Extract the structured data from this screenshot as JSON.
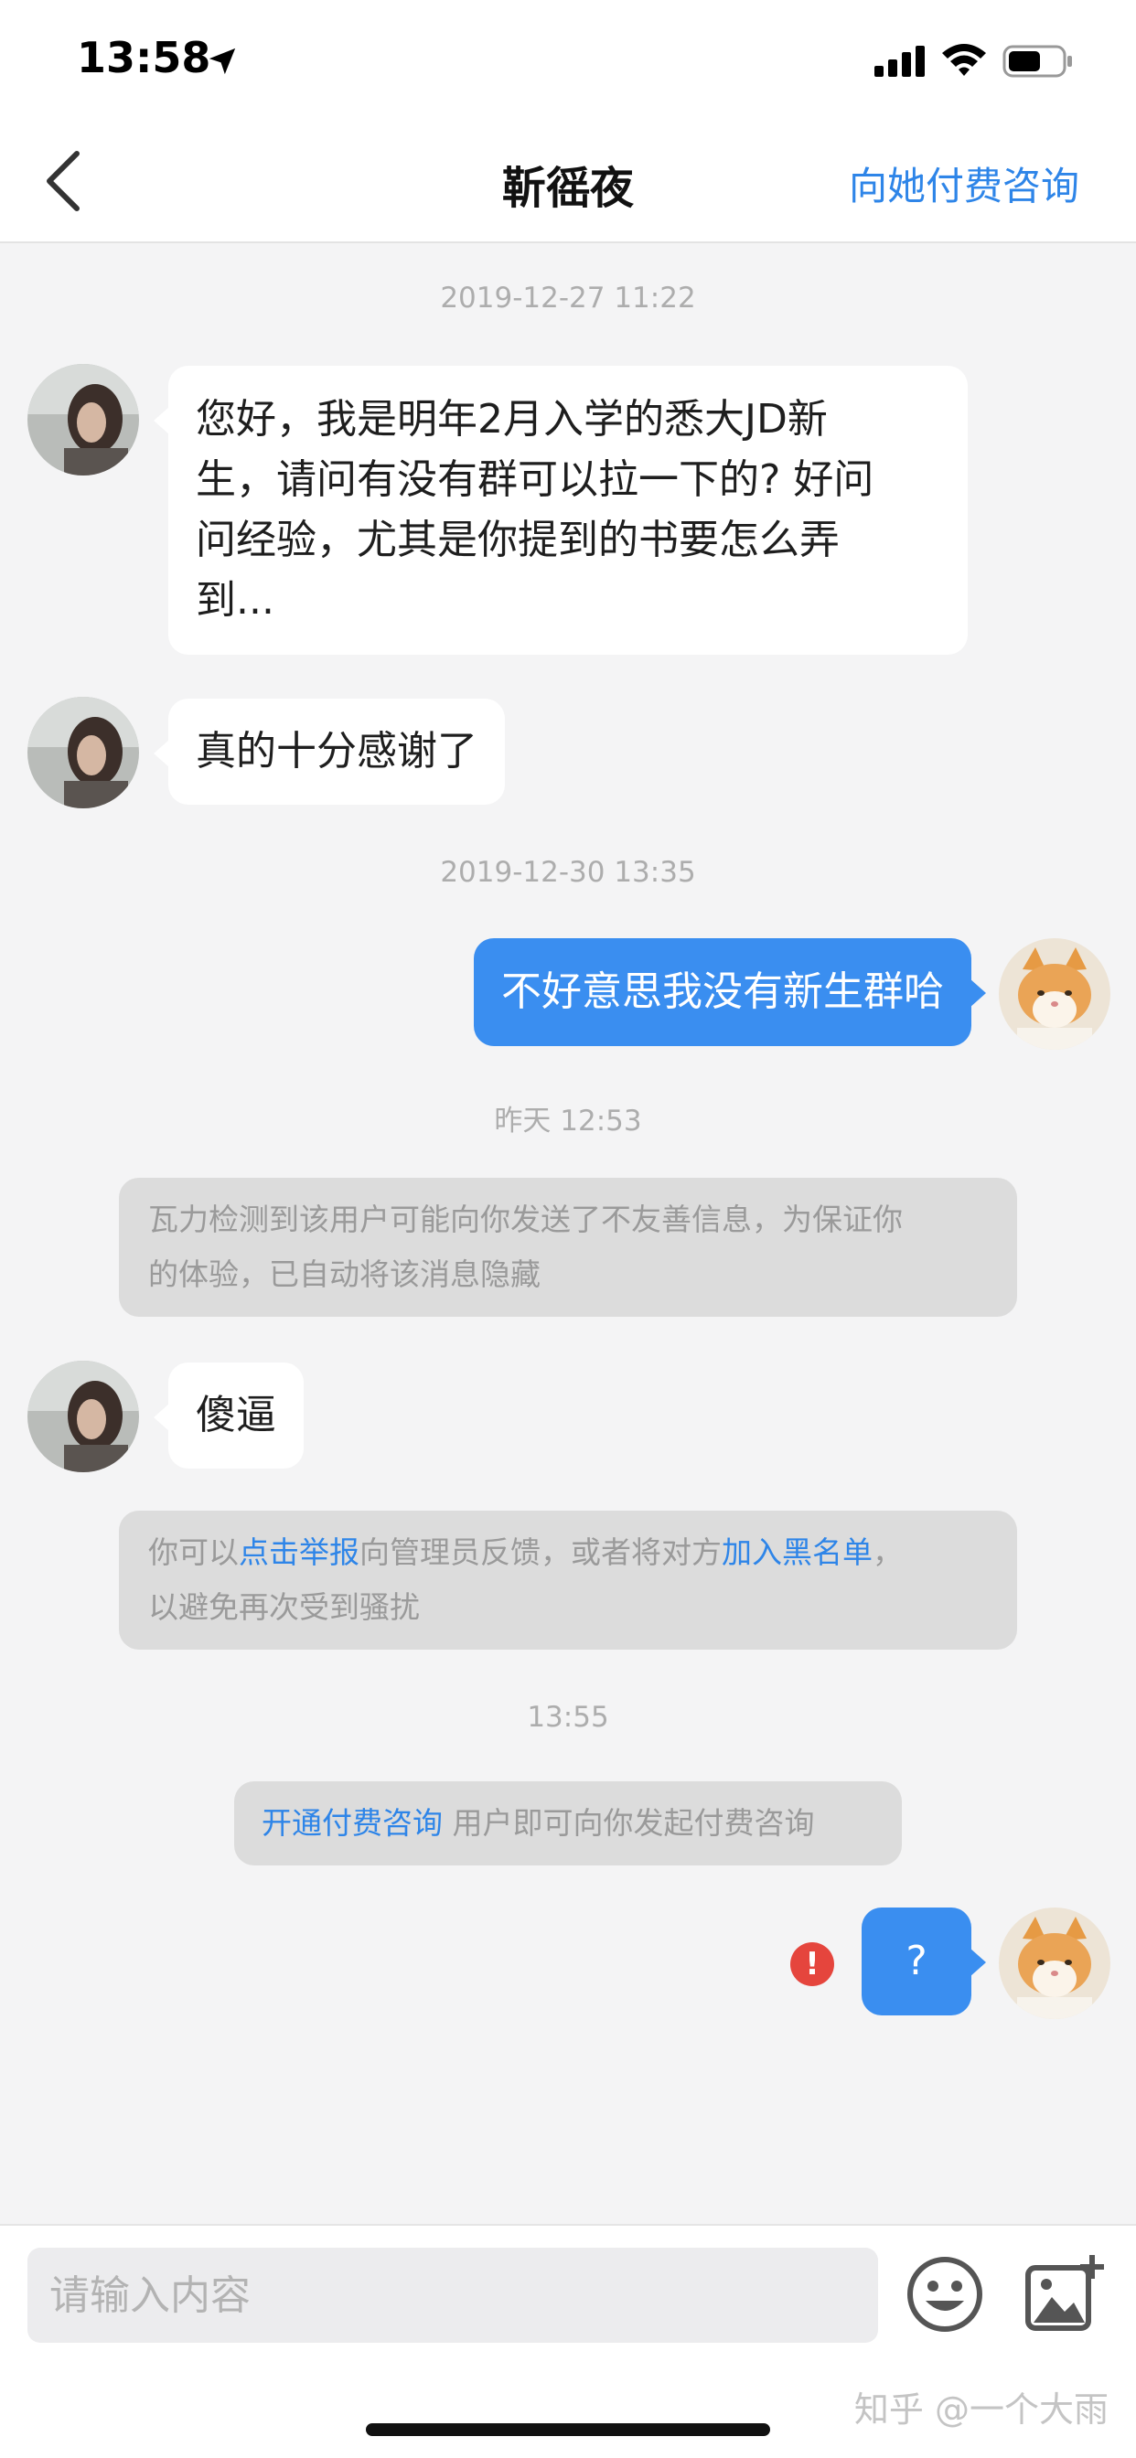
{
  "status_bar": {
    "time": "13:58",
    "icons": [
      "location-arrow-icon",
      "signal-icon",
      "wifi-icon",
      "battery-icon"
    ]
  },
  "nav": {
    "back_icon": "chevron-left-icon",
    "title": "靳徭夜",
    "action_label": "向她付费咨询"
  },
  "chat": {
    "timestamps": [
      "2019-12-27 11:22",
      "2019-12-30 13:35",
      "昨天 12:53",
      "13:55"
    ],
    "messages": [
      {
        "from": "other",
        "lines": [
          "您好，我是明年2月入学的悉大JD新",
          "生，请问有没有群可以拉一下的? 好问",
          "问经验，尤其是你提到的书要怎么弄",
          "到..."
        ]
      },
      {
        "from": "other",
        "text": "真的十分感谢了"
      },
      {
        "from": "me",
        "text": "不好意思我没有新生群哈"
      },
      {
        "from": "other",
        "text": "傻逼"
      },
      {
        "from": "me",
        "text": "?",
        "status": "failed"
      }
    ],
    "system_notes": {
      "hidden_notice": {
        "line1": "瓦力检测到该用户可能向你发送了不友善信息，为保证你",
        "line2": "的体验，已自动将该消息隐藏"
      },
      "report_notice": {
        "prefix": "你可以",
        "report_link": "点击举报",
        "middle": "向管理员反馈，或者将对方",
        "blacklist_link": "加入黑名单",
        "suffix": "，",
        "line2": "以避免再次受到骚扰"
      },
      "paid_notice": {
        "link": "开通付费咨询",
        "text": " 用户即可向你发起付费咨询"
      }
    }
  },
  "input_bar": {
    "placeholder": "请输入内容",
    "emoji_icon": "smiley-icon",
    "image_icon": "add-image-icon"
  },
  "watermark": "知乎 @一个大雨",
  "colors": {
    "accent": "#2e85e8",
    "outgoing_bubble": "#3a8ef0",
    "error": "#e5453d",
    "background": "#f4f4f5"
  }
}
